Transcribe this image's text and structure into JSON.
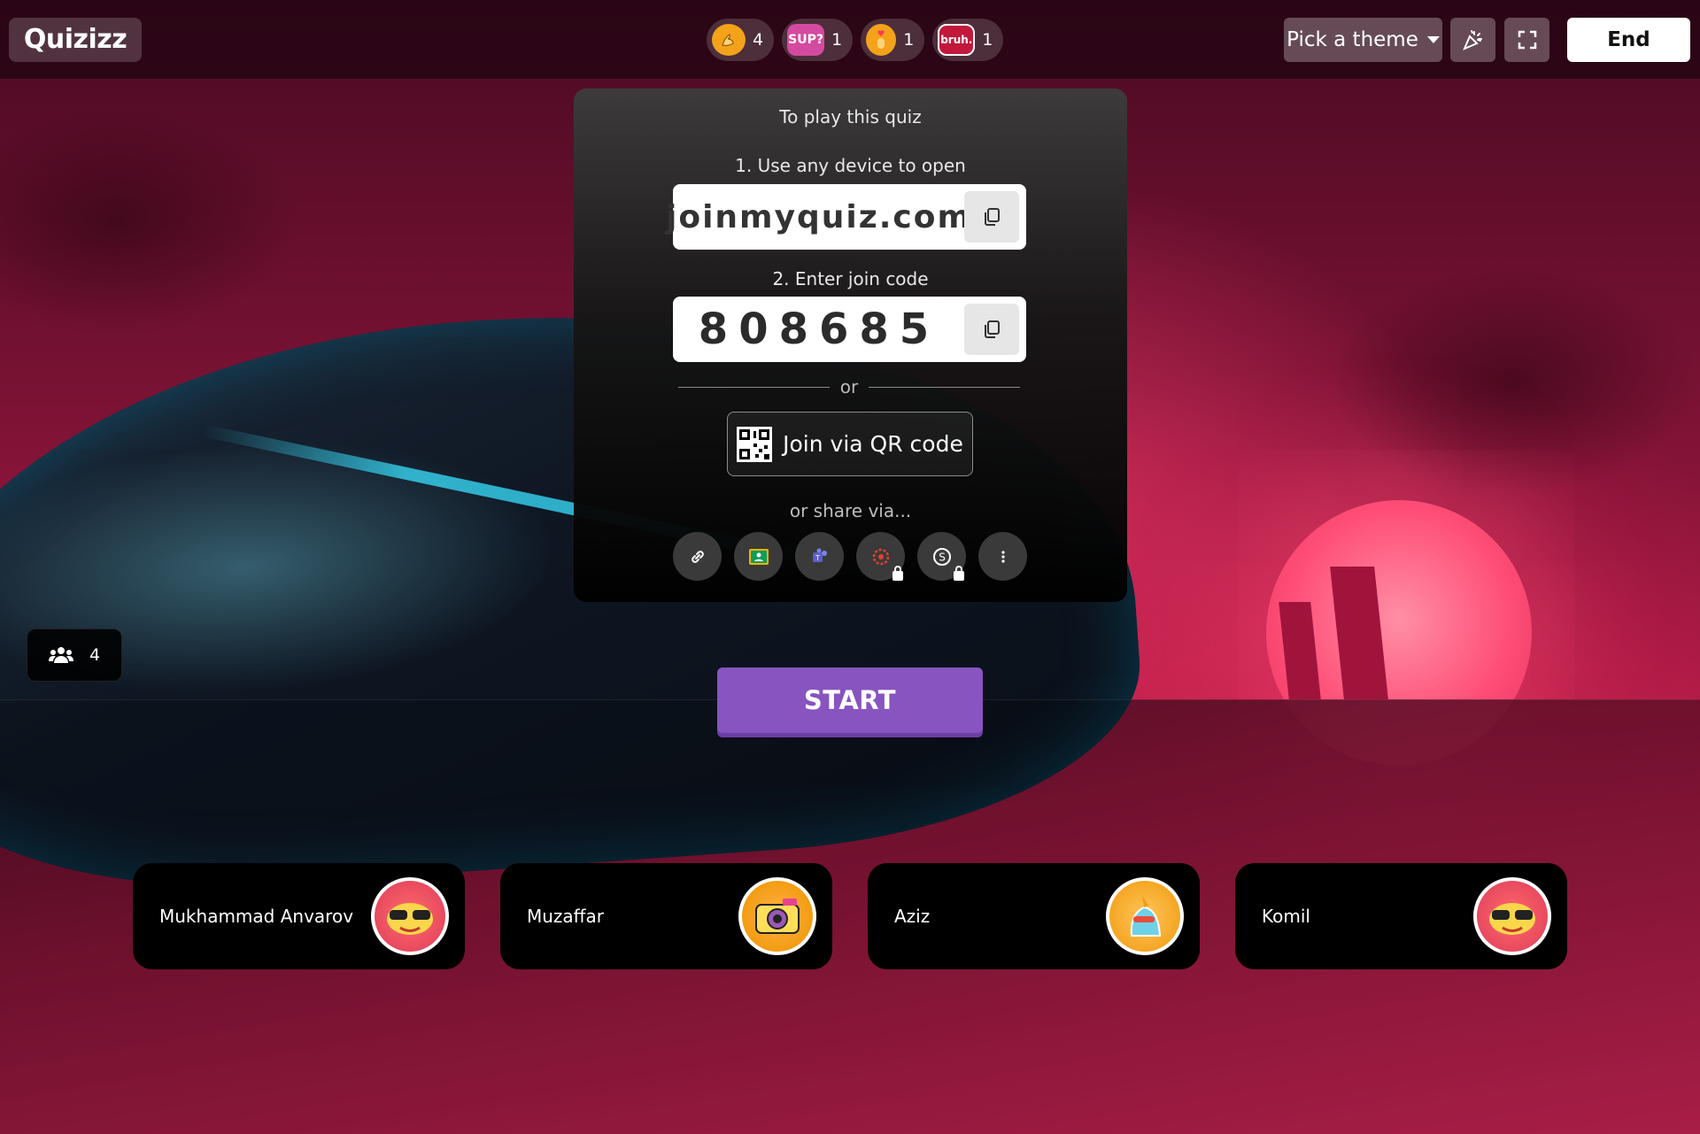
{
  "app": {
    "logo_text": "Quizizz"
  },
  "reactions": [
    {
      "icon": "flexed-biceps-icon",
      "count": "4"
    },
    {
      "icon": "sup-sticker-icon",
      "count": "1"
    },
    {
      "icon": "finger-heart-icon",
      "count": "1"
    },
    {
      "icon": "bruh-sticker-icon",
      "count": "1"
    }
  ],
  "toolbar": {
    "theme_label": "Pick a theme",
    "effects_icon": "party-popper-icon",
    "fullscreen_icon": "fullscreen-icon",
    "end_label": "End"
  },
  "join_card": {
    "heading": "To play this quiz",
    "step1": "1. Use any device to open",
    "url": "joinmyquiz.com",
    "step2": "2. Enter join code",
    "join_code": "808685",
    "or_text": "or",
    "qr_label": "Join via QR code",
    "share_label": "or share via...",
    "share_options": [
      {
        "icon": "link-icon",
        "locked": false
      },
      {
        "icon": "google-classroom-icon",
        "locked": false
      },
      {
        "icon": "microsoft-teams-icon",
        "locked": false
      },
      {
        "icon": "canvas-icon",
        "locked": true
      },
      {
        "icon": "schoology-icon",
        "locked": true
      },
      {
        "icon": "more-options-icon",
        "locked": false
      }
    ]
  },
  "player_count": "4",
  "start_label": "START",
  "players": [
    {
      "name": "Mukhammad Anvarov",
      "avatar": "sunglasses-face-avatar"
    },
    {
      "name": "Muzaffar",
      "avatar": "camera-avatar"
    },
    {
      "name": "Aziz",
      "avatar": "unicorn-avatar"
    },
    {
      "name": "Komil",
      "avatar": "sunglasses-face-avatar"
    }
  ],
  "colors": {
    "accent_purple": "#8854c0",
    "card_bg": "#1a1a1a",
    "background_pink": "#c42252"
  }
}
